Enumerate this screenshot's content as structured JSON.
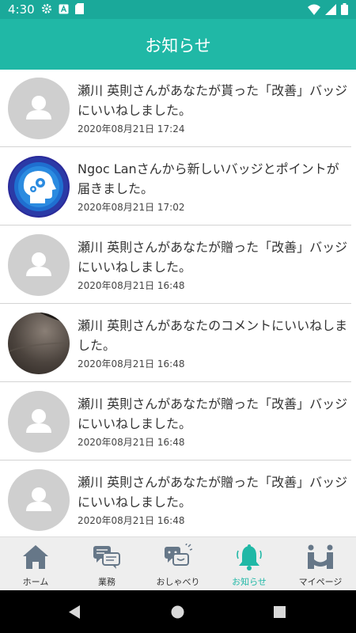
{
  "status": {
    "time": "4:30"
  },
  "app_bar": {
    "title": "お知らせ"
  },
  "notifications": [
    {
      "message": "瀬川 英則さんがあなたが貰った「改善」バッジにいいねしました。",
      "date": "2020年08月21日 17:24",
      "avatar": "default-user"
    },
    {
      "message": "Ngoc Lanさんから新しいバッジとポイントが届きました。",
      "date": "2020年08月21日 17:02",
      "avatar": "head-gears"
    },
    {
      "message": "瀬川 英則さんがあなたが贈った「改善」バッジにいいねしました。",
      "date": "2020年08月21日 16:48",
      "avatar": "default-user"
    },
    {
      "message": "瀬川 英則さんがあなたのコメントにいいねしました。",
      "date": "2020年08月21日 16:48",
      "avatar": "photo"
    },
    {
      "message": "瀬川 英則さんがあなたが贈った「改善」バッジにいいねしました。",
      "date": "2020年08月21日 16:48",
      "avatar": "default-user"
    },
    {
      "message": "瀬川 英則さんがあなたが贈った「改善」バッジにいいねしました。",
      "date": "2020年08月21日 16:48",
      "avatar": "default-user"
    }
  ],
  "bottom_nav": {
    "items": [
      {
        "label": "ホーム",
        "icon": "home-icon"
      },
      {
        "label": "業務",
        "icon": "chat-bubbles-icon"
      },
      {
        "label": "おしゃべり",
        "icon": "talk-icon"
      },
      {
        "label": "お知らせ",
        "icon": "bell-icon",
        "active": true
      },
      {
        "label": "マイページ",
        "icon": "mypage-icon"
      }
    ]
  },
  "colors": {
    "accent": "#20b8a6",
    "status_bar": "#1aa99a",
    "avatar_bg": "#cfcfcf",
    "nav_icon": "#667788"
  }
}
